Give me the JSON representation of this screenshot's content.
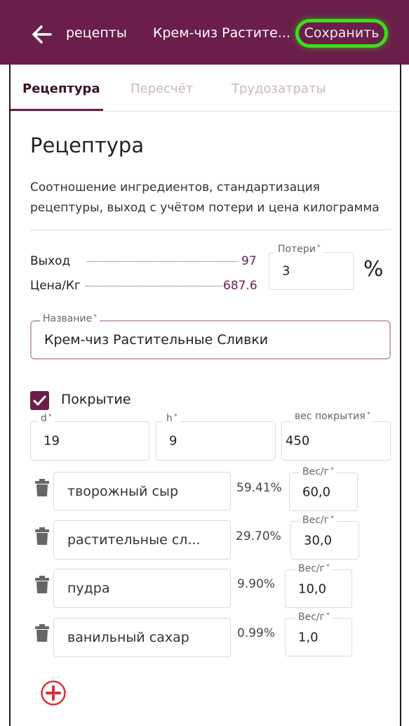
{
  "header": {
    "back_label": "рецепты",
    "title": "Крем-чиз Растите...",
    "save_label": "Сохранить"
  },
  "tabs": [
    {
      "label": "Рецептура",
      "active": true
    },
    {
      "label": "Пересчёт",
      "active": false
    },
    {
      "label": "Трудозатраты",
      "active": false
    }
  ],
  "section": {
    "title": "Рецептура",
    "description": "Соотношение ингредиентов, стандартизация рецептуры, выход с учётом потери и цена килограмма"
  },
  "stats": {
    "yield_label": "Выход",
    "yield_value": "97",
    "price_label": "Цена/Кг",
    "price_value": "687.6"
  },
  "losses": {
    "label": "Потери",
    "value": "3",
    "unit": "%"
  },
  "name_field": {
    "label": "Название",
    "value": "Крем-чиз Растительные Сливки"
  },
  "coating": {
    "label": "Покрытие",
    "checked": true,
    "d": {
      "label": "d",
      "value": "19"
    },
    "h": {
      "label": "h",
      "value": "9"
    },
    "weight": {
      "label": "вес покрытия",
      "value": "450"
    }
  },
  "ingredients": [
    {
      "name": "творожный сыр",
      "percent": "59.41%",
      "weight_label": "Вес/г",
      "weight": "60,0"
    },
    {
      "name": "растительные сл...",
      "percent": "29.70%",
      "weight_label": "Вес/г",
      "weight": "30,0"
    },
    {
      "name": "пудра",
      "percent": "9.90%",
      "weight_label": "Вес/г",
      "weight": "10,0"
    },
    {
      "name": "ванильный сахар",
      "percent": "0.99%",
      "weight_label": "Вес/г",
      "weight": "1,0"
    }
  ],
  "colors": {
    "brand": "#6b1e4a",
    "highlight": "#39e01a",
    "add_icon": "#d6313a"
  },
  "icons": [
    "arrow-back-icon",
    "checkbox-checked-icon",
    "trash-icon",
    "add-circle-icon"
  ]
}
